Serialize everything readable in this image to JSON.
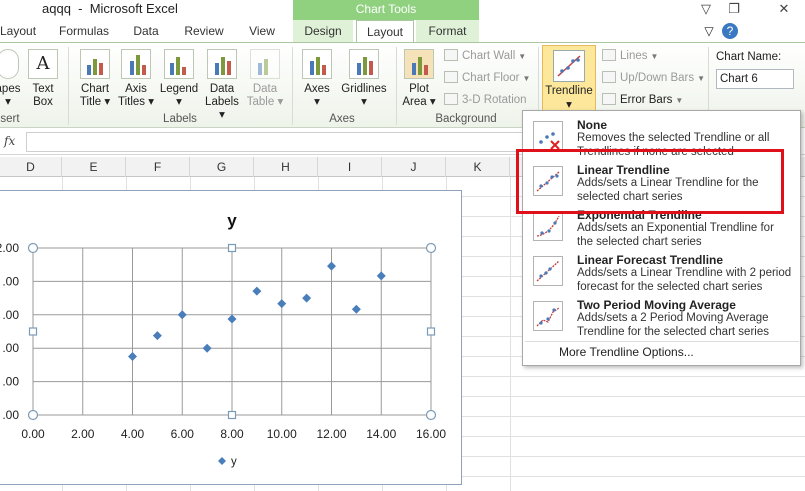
{
  "window": {
    "title": "aqqq  -  Microsoft Excel",
    "context_header": "Chart Tools",
    "help_icon": "?",
    "restore_icon": "❐",
    "close_icon": "✕",
    "minimize_icon": "▽"
  },
  "tabs": {
    "layout_left": "Layout",
    "formulas": "Formulas",
    "data": "Data",
    "review": "Review",
    "view": "View",
    "design": "Design",
    "layout": "Layout",
    "format": "Format"
  },
  "ribbon": {
    "shapes": "apes",
    "shapes_2": "▾",
    "text_box_1": "Text",
    "text_box_2": "Box",
    "chart_title_1": "Chart",
    "chart_title_2": "Title ▾",
    "axis_titles_1": "Axis",
    "axis_titles_2": "Titles ▾",
    "legend": "Legend",
    "legend_2": "▾",
    "data_labels_1": "Data",
    "data_labels_2": "Labels ▾",
    "data_table_1": "Data",
    "data_table_2": "Table ▾",
    "axes": "Axes",
    "axes_2": "▾",
    "gridlines": "Gridlines",
    "gridlines_2": "▾",
    "plot_area_1": "Plot",
    "plot_area_2": "Area ▾",
    "chart_wall": "Chart Wall",
    "chart_floor": "Chart Floor",
    "rotation": "3-D Rotation",
    "trendline": "Trendline",
    "trendline_2": "▾",
    "lines": "Lines",
    "updown_bars": "Up/Down Bars",
    "error_bars": "Error Bars",
    "chart_name_label": "Chart Name:",
    "chart_name_value": "Chart 6",
    "group_insert": "sert",
    "group_labels": "Labels",
    "group_axes": "Axes",
    "group_background": "Background"
  },
  "formula_bar": {
    "fx": "fx",
    "value": ""
  },
  "columns": [
    "D",
    "E",
    "F",
    "G",
    "H",
    "I",
    "J",
    "K"
  ],
  "chart_data": {
    "type": "scatter",
    "title": "y",
    "legend": [
      "y"
    ],
    "legend_position": "bottom",
    "x_ticks": [
      "0.00",
      "2.00",
      "4.00",
      "6.00",
      "8.00",
      "10.00",
      "12.00",
      "14.00",
      "16.00"
    ],
    "y_ticks": [
      ".00",
      ".00",
      ".00",
      ".00",
      ".00",
      "2.00"
    ],
    "xlim": [
      0,
      16
    ],
    "ylim": [
      0,
      12
    ],
    "grid": true,
    "series": [
      {
        "name": "y",
        "color": "#4a7ebb",
        "points": [
          [
            4,
            4.2
          ],
          [
            5,
            5.7
          ],
          [
            6,
            7.2
          ],
          [
            7,
            4.8
          ],
          [
            8,
            6.9
          ],
          [
            9,
            8.9
          ],
          [
            10,
            8.0
          ],
          [
            11,
            8.4
          ],
          [
            12,
            10.7
          ],
          [
            13,
            7.6
          ],
          [
            14,
            10.0
          ]
        ]
      }
    ]
  },
  "trend_menu": {
    "items": [
      {
        "title": "None",
        "desc": "Removes the selected Trendline or all Trendlines if none are selected"
      },
      {
        "title": "Linear Trendline",
        "desc": "Adds/sets a Linear Trendline for the selected chart series"
      },
      {
        "title": "Exponential Trendline",
        "desc": "Adds/sets an Exponential Trendline for the selected chart series"
      },
      {
        "title": "Linear Forecast Trendline",
        "desc": "Adds/sets a Linear Trendline with 2 period forecast for the selected chart series"
      },
      {
        "title": "Two Period Moving Average",
        "desc": "Adds/sets a 2 Period Moving Average Trendline for the selected chart series"
      }
    ],
    "more": "More Trendline Options..."
  },
  "colors": {
    "highlight": "#e0101a",
    "context": "#8fd17f",
    "series": "#4a7ebb"
  }
}
